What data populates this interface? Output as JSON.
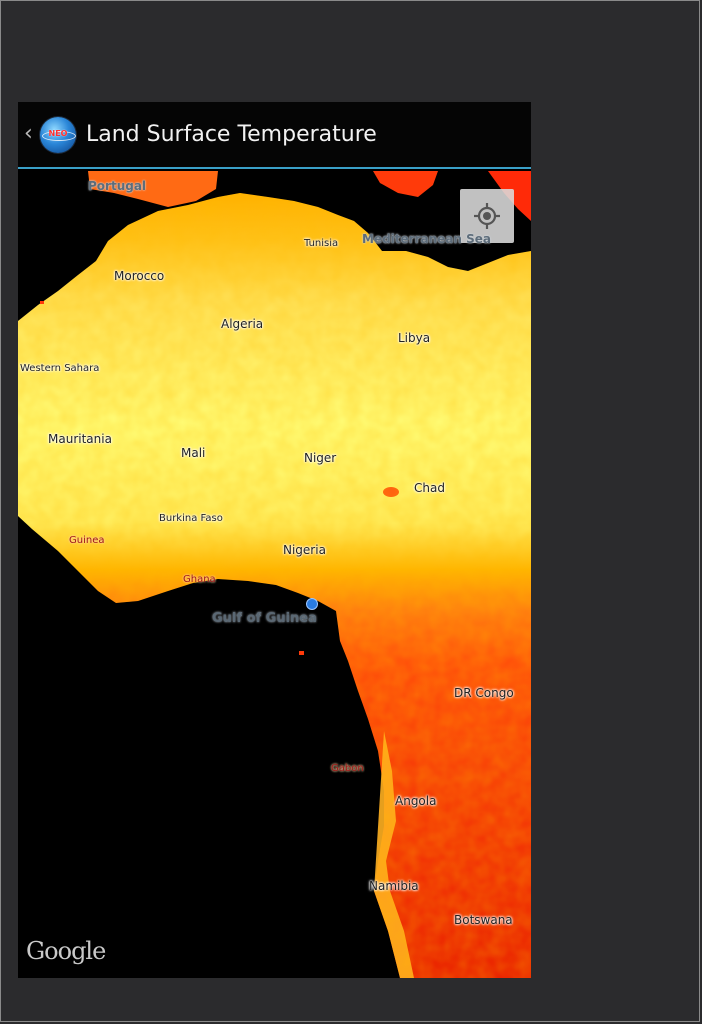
{
  "app": {
    "title": "Land Surface Temperature",
    "icon_text": "NEO",
    "back_icon": "chevron-left-icon",
    "accent_color": "#3aa0c8"
  },
  "map": {
    "labels": {
      "portugal": "Portugal",
      "tunisia": "Tunisia",
      "mediterranean": "Mediterranean Sea",
      "morocco": "Morocco",
      "algeria": "Algeria",
      "libya": "Libya",
      "western_sahara": "Western Sahara",
      "mauritania": "Mauritania",
      "mali": "Mali",
      "niger": "Niger",
      "chad": "Chad",
      "burkina_faso": "Burkina Faso",
      "guinea": "Guinea",
      "nigeria": "Nigeria",
      "ghana": "Ghana",
      "gulf_of_guinea": "Gulf of Guinea",
      "gabon": "Gabon",
      "dr_congo": "DR Congo",
      "angola": "Angola",
      "namibia": "Namibia",
      "botswana": "Botswana"
    },
    "attribution": "Google",
    "locate_icon": "my-location-icon",
    "colors": {
      "hot": "#ffff7a",
      "warm": "#ffb000",
      "mid": "#ff5a10",
      "cool": "#e51a00",
      "water": "#000000"
    }
  }
}
